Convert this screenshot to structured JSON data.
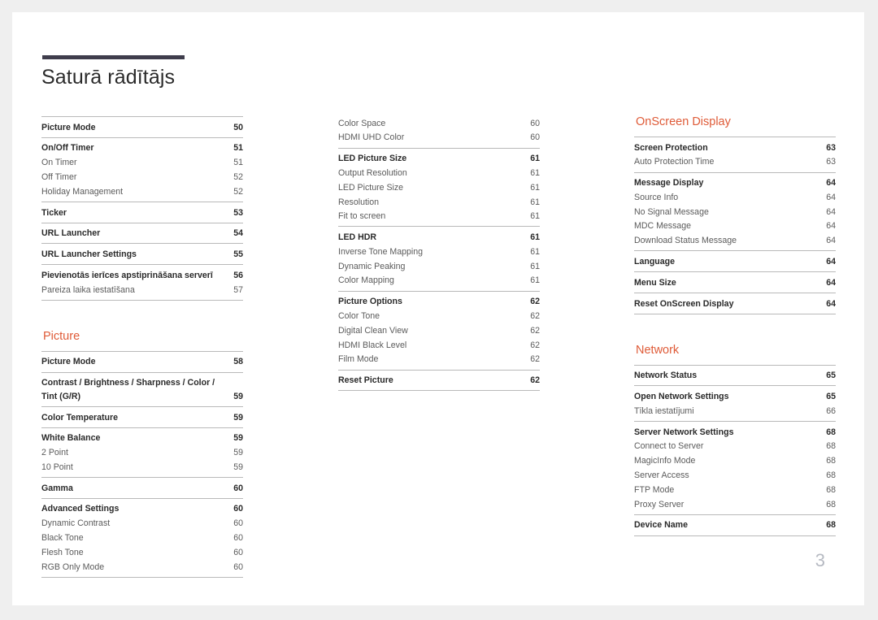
{
  "document": {
    "title": "Saturā rādītājs",
    "page_number": "3",
    "accent_color": "#df5b38",
    "rule_color": "#3f3d4c"
  },
  "columns": [
    {
      "name": "column-1",
      "sections": [
        {
          "heading": null,
          "groups": [
            {
              "entries": [
                {
                  "label": "Picture Mode",
                  "page": "50",
                  "level": "main"
                }
              ]
            },
            {
              "entries": [
                {
                  "label": "On/Off Timer",
                  "page": "51",
                  "level": "main"
                },
                {
                  "label": "On Timer",
                  "page": "51",
                  "level": "sub"
                },
                {
                  "label": "Off Timer",
                  "page": "52",
                  "level": "sub"
                },
                {
                  "label": "Holiday Management",
                  "page": "52",
                  "level": "sub"
                }
              ]
            },
            {
              "entries": [
                {
                  "label": "Ticker",
                  "page": "53",
                  "level": "main"
                }
              ]
            },
            {
              "entries": [
                {
                  "label": "URL Launcher",
                  "page": "54",
                  "level": "main"
                }
              ]
            },
            {
              "entries": [
                {
                  "label": "URL Launcher Settings",
                  "page": "55",
                  "level": "main"
                }
              ]
            },
            {
              "entries": [
                {
                  "label": "Pievienotās ierīces apstiprināšana serverī",
                  "page": "56",
                  "level": "main"
                },
                {
                  "label": "Pareiza laika iestatīšana",
                  "page": "57",
                  "level": "sub"
                }
              ]
            }
          ]
        },
        {
          "heading": "Picture",
          "groups": [
            {
              "entries": [
                {
                  "label": "Picture Mode",
                  "page": "58",
                  "level": "main"
                }
              ]
            },
            {
              "entries": [
                {
                  "label": "Contrast / Brightness / Sharpness / Color / Tint (G/R)",
                  "page": "59",
                  "level": "main",
                  "wrap": true
                }
              ]
            },
            {
              "entries": [
                {
                  "label": "Color Temperature",
                  "page": "59",
                  "level": "main"
                }
              ]
            },
            {
              "entries": [
                {
                  "label": "White Balance",
                  "page": "59",
                  "level": "main"
                },
                {
                  "label": "2 Point",
                  "page": "59",
                  "level": "sub"
                },
                {
                  "label": "10 Point",
                  "page": "59",
                  "level": "sub"
                }
              ]
            },
            {
              "entries": [
                {
                  "label": "Gamma",
                  "page": "60",
                  "level": "main"
                }
              ]
            },
            {
              "entries": [
                {
                  "label": "Advanced Settings",
                  "page": "60",
                  "level": "main"
                },
                {
                  "label": "Dynamic Contrast",
                  "page": "60",
                  "level": "sub"
                },
                {
                  "label": "Black Tone",
                  "page": "60",
                  "level": "sub"
                },
                {
                  "label": "Flesh Tone",
                  "page": "60",
                  "level": "sub"
                },
                {
                  "label": "RGB Only Mode",
                  "page": "60",
                  "level": "sub"
                }
              ]
            }
          ]
        }
      ]
    },
    {
      "name": "column-2",
      "sections": [
        {
          "heading": null,
          "groups": [
            {
              "continuation": true,
              "entries": [
                {
                  "label": "Color Space",
                  "page": "60",
                  "level": "sub"
                },
                {
                  "label": "HDMI UHD Color",
                  "page": "60",
                  "level": "sub"
                }
              ]
            },
            {
              "entries": [
                {
                  "label": "LED Picture Size",
                  "page": "61",
                  "level": "main"
                },
                {
                  "label": "Output Resolution",
                  "page": "61",
                  "level": "sub"
                },
                {
                  "label": "LED Picture Size",
                  "page": "61",
                  "level": "sub"
                },
                {
                  "label": "Resolution",
                  "page": "61",
                  "level": "sub"
                },
                {
                  "label": "Fit to screen",
                  "page": "61",
                  "level": "sub"
                }
              ]
            },
            {
              "entries": [
                {
                  "label": "LED HDR",
                  "page": "61",
                  "level": "main"
                },
                {
                  "label": "Inverse Tone Mapping",
                  "page": "61",
                  "level": "sub"
                },
                {
                  "label": "Dynamic Peaking",
                  "page": "61",
                  "level": "sub"
                },
                {
                  "label": "Color Mapping",
                  "page": "61",
                  "level": "sub"
                }
              ]
            },
            {
              "entries": [
                {
                  "label": "Picture Options",
                  "page": "62",
                  "level": "main"
                },
                {
                  "label": "Color Tone",
                  "page": "62",
                  "level": "sub"
                },
                {
                  "label": "Digital Clean View",
                  "page": "62",
                  "level": "sub"
                },
                {
                  "label": "HDMI Black Level",
                  "page": "62",
                  "level": "sub"
                },
                {
                  "label": "Film Mode",
                  "page": "62",
                  "level": "sub"
                }
              ]
            },
            {
              "entries": [
                {
                  "label": "Reset Picture",
                  "page": "62",
                  "level": "main"
                }
              ]
            }
          ]
        }
      ]
    },
    {
      "name": "column-3",
      "sections": [
        {
          "heading": "OnScreen Display",
          "groups": [
            {
              "entries": [
                {
                  "label": "Screen Protection",
                  "page": "63",
                  "level": "main"
                },
                {
                  "label": "Auto Protection Time",
                  "page": "63",
                  "level": "sub"
                }
              ]
            },
            {
              "entries": [
                {
                  "label": "Message Display",
                  "page": "64",
                  "level": "main"
                },
                {
                  "label": "Source Info",
                  "page": "64",
                  "level": "sub"
                },
                {
                  "label": "No Signal Message",
                  "page": "64",
                  "level": "sub"
                },
                {
                  "label": "MDC Message",
                  "page": "64",
                  "level": "sub"
                },
                {
                  "label": "Download Status Message",
                  "page": "64",
                  "level": "sub"
                }
              ]
            },
            {
              "entries": [
                {
                  "label": "Language",
                  "page": "64",
                  "level": "main"
                }
              ]
            },
            {
              "entries": [
                {
                  "label": "Menu Size",
                  "page": "64",
                  "level": "main"
                }
              ]
            },
            {
              "entries": [
                {
                  "label": "Reset OnScreen Display",
                  "page": "64",
                  "level": "main"
                }
              ]
            }
          ]
        },
        {
          "heading": "Network",
          "groups": [
            {
              "entries": [
                {
                  "label": "Network Status",
                  "page": "65",
                  "level": "main"
                }
              ]
            },
            {
              "entries": [
                {
                  "label": "Open Network Settings",
                  "page": "65",
                  "level": "main"
                },
                {
                  "label": "Tīkla iestatījumi",
                  "page": "66",
                  "level": "sub"
                }
              ]
            },
            {
              "entries": [
                {
                  "label": "Server Network Settings",
                  "page": "68",
                  "level": "main"
                },
                {
                  "label": "Connect to Server",
                  "page": "68",
                  "level": "sub"
                },
                {
                  "label": "MagicInfo Mode",
                  "page": "68",
                  "level": "sub"
                },
                {
                  "label": "Server Access",
                  "page": "68",
                  "level": "sub"
                },
                {
                  "label": "FTP Mode",
                  "page": "68",
                  "level": "sub"
                },
                {
                  "label": "Proxy Server",
                  "page": "68",
                  "level": "sub"
                }
              ]
            },
            {
              "entries": [
                {
                  "label": "Device Name",
                  "page": "68",
                  "level": "main"
                }
              ]
            }
          ]
        }
      ]
    }
  ]
}
